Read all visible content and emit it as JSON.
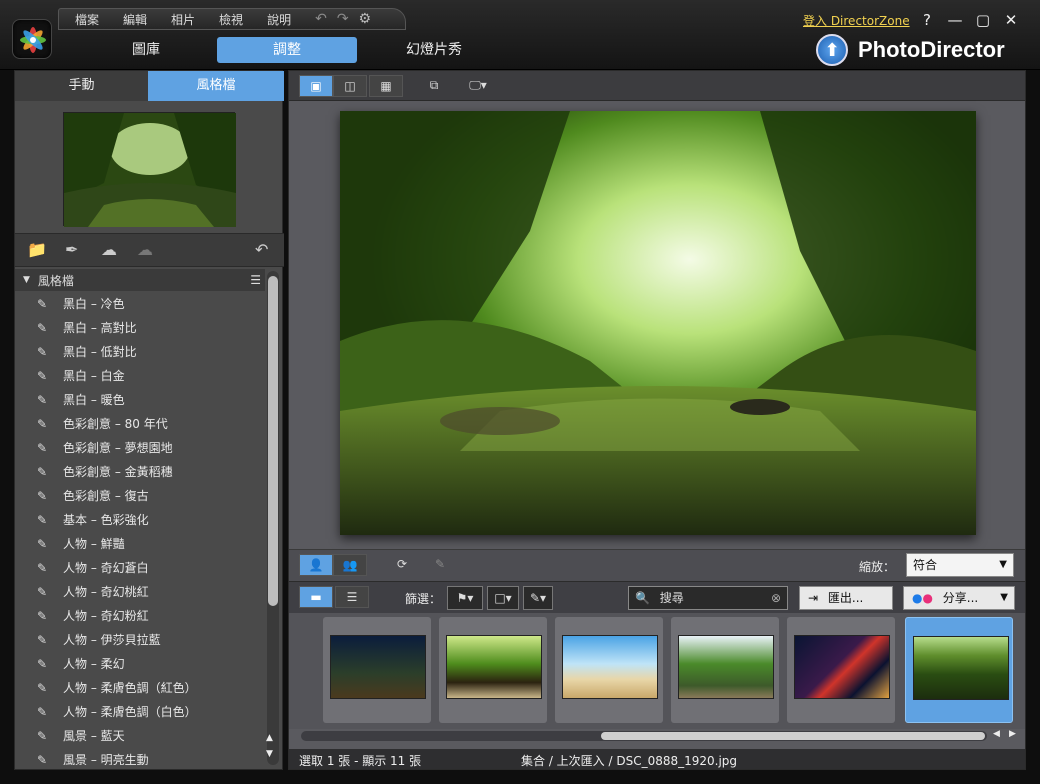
{
  "menu": {
    "items": [
      "檔案",
      "編輯",
      "相片",
      "檢視",
      "說明"
    ]
  },
  "mode_tabs": {
    "library": "圖庫",
    "adjust": "調整",
    "slideshow": "幻燈片秀"
  },
  "header": {
    "login": "登入 DirectorZone",
    "help": "?",
    "minimize": "—",
    "maximize": "▢",
    "close": "✕",
    "brand": "PhotoDirector"
  },
  "left_tabs": {
    "manual": "手動",
    "preset": "風格檔"
  },
  "preset_section": {
    "title": "風格檔"
  },
  "presets": [
    "黑白 – 冷色",
    "黑白 – 高對比",
    "黑白 – 低對比",
    "黑白 – 白金",
    "黑白 – 暖色",
    "色彩創意 – 80 年代",
    "色彩創意 – 夢想園地",
    "色彩創意 – 金黃稻穗",
    "色彩創意 – 復古",
    "基本 – 色彩強化",
    "人物 – 鮮豔",
    "人物 – 奇幻蒼白",
    "人物 – 奇幻桃紅",
    "人物 – 奇幻粉紅",
    "人物 – 伊莎貝拉藍",
    "人物 – 柔幻",
    "人物 – 柔膚色調（紅色）",
    "人物 – 柔膚色調（白色）",
    "風景 – 藍天",
    "風景 – 明亮生動"
  ],
  "toolbar": {
    "zoom_label": "縮放：",
    "zoom_value": "符合",
    "filter_label": "篩選：",
    "search_placeholder": "搜尋",
    "export_label": "匯出...",
    "share_label": "分享..."
  },
  "status": {
    "selection": "選取 1 張 - 顯示 11 張",
    "path": "集合 / 上次匯入 / DSC_0888_1920.jpg"
  },
  "colors": {
    "accent": "#5fa2e2",
    "login": "#f2d250"
  }
}
